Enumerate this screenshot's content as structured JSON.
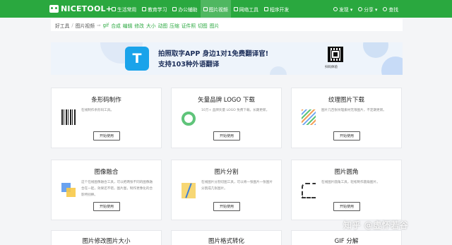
{
  "header": {
    "logo": "NICETOOL+",
    "nav": [
      {
        "label": "生活常用"
      },
      {
        "label": "教育学习"
      },
      {
        "label": "办公辅助"
      },
      {
        "label": "图片视频"
      },
      {
        "label": "网络工具"
      },
      {
        "label": "程序开发"
      }
    ],
    "right": [
      {
        "label": "发现 ▾"
      },
      {
        "label": "分享 ▾"
      },
      {
        "label": "查找"
      }
    ]
  },
  "breadcrumb": {
    "home": "好工具",
    "sep": "/",
    "category": "图片视频",
    "arrow": "⇒",
    "keywords": [
      "gif",
      "合成",
      "编辑",
      "修改",
      "大小",
      "动图",
      "压缩",
      "证件照",
      "切图",
      "图片"
    ]
  },
  "banner": {
    "icon_letter": "T",
    "line1": "拍照取字APP 身边1对1免费翻译官!",
    "line2": "支持103种外语翻译",
    "qr_label": "扫码体验"
  },
  "cards": [
    {
      "title": "条形码制作",
      "desc": "在线制作条形码工具。",
      "button": "开始使用"
    },
    {
      "title": "矢量品牌 LOGO 下载",
      "desc": "10万+ 品牌矢量 LOGO 免费下载，长期更新。",
      "button": "开始使用"
    },
    {
      "title": "纹理图片下载",
      "desc": "图片几百张纹理素材无限图片，不定期更新。",
      "button": "开始使用"
    },
    {
      "title": "图像融合",
      "desc": "这个在线图像融合工具，可以把两张不同的图像融合在一起，效果还不错，图片图，制作更像化的合影特别棒。",
      "button": "开始使用"
    },
    {
      "title": "图片分割",
      "desc": "在线图片分割切图工具，可以将一张图片一张图片分割成几张图片。",
      "button": "开始使用"
    },
    {
      "title": "图片圆角",
      "desc": "在线图片圆角工具，轻松制作圆角图片。",
      "button": "开始使用"
    },
    {
      "title": "图片修改图片大小"
    },
    {
      "title": "图片格式转化"
    },
    {
      "title": "GIF 分解"
    }
  ],
  "watermark": "知乎 @虚怀若谷",
  "colors": {
    "brand_green": "#2aa83f",
    "app_blue": "#1aa3ea",
    "bg": "#f4f5f7"
  }
}
